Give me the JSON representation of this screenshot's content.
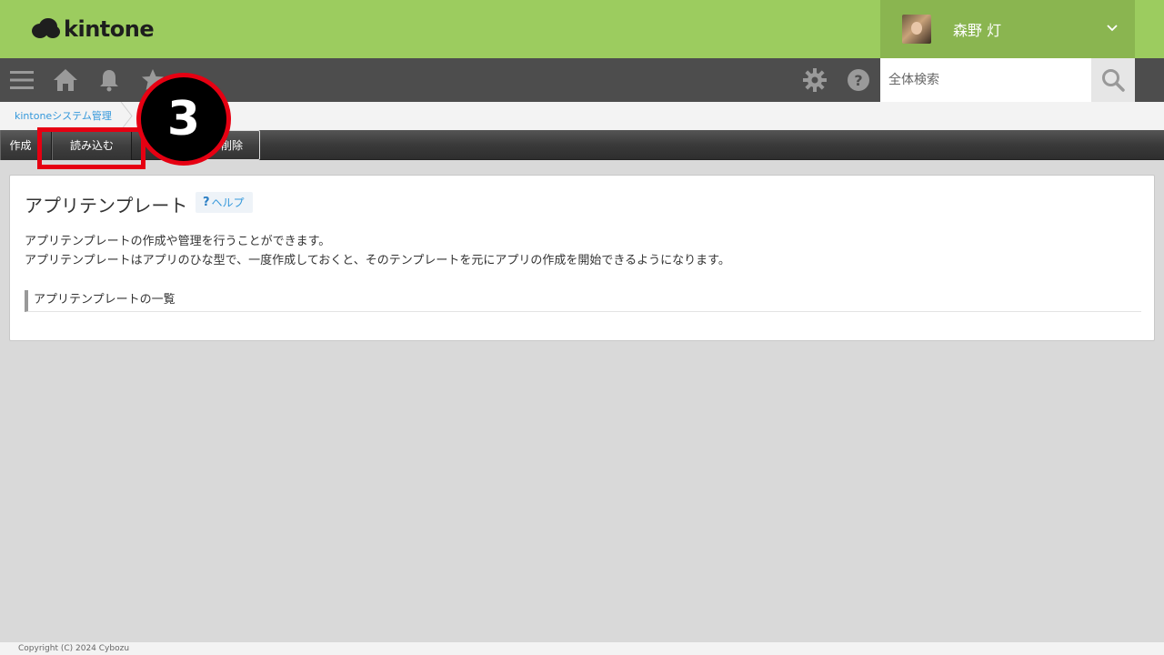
{
  "header": {
    "logo_text": "kintone",
    "user_name": "森野 灯",
    "brand_color": "#9ccc5f"
  },
  "nav": {
    "icons": [
      "menu-icon",
      "home-icon",
      "bell-icon",
      "star-icon",
      "gear-icon",
      "help-icon",
      "search-icon"
    ],
    "search_placeholder": "全体検索"
  },
  "breadcrumb": {
    "items": [
      "kintoneシステム管理"
    ]
  },
  "toolbar": {
    "buttons": [
      "作成",
      "読み込む",
      "削除"
    ]
  },
  "annotation": {
    "step_number": "3",
    "highlight_color": "#e60012"
  },
  "panel": {
    "title": "アプリテンプレート",
    "help_label": "ヘルプ",
    "help_mark": "?",
    "description_lines": [
      "アプリテンプレートの作成や管理を行うことができます。",
      "アプリテンプレートはアプリのひな型で、一度作成しておくと、そのテンプレートを元にアプリの作成を開始できるようになります。"
    ],
    "section_heading": "アプリテンプレートの一覧"
  },
  "footer": {
    "copyright": "Copyright (C) 2024 Cybozu"
  }
}
